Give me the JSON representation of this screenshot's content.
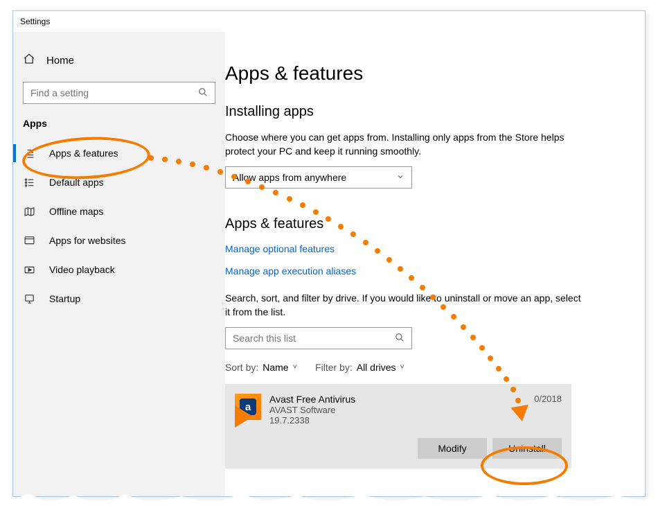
{
  "window_title": "Settings",
  "sidebar": {
    "home_label": "Home",
    "search_placeholder": "Find a setting",
    "section_label": "Apps",
    "items": [
      {
        "label": "Apps & features",
        "active": true
      },
      {
        "label": "Default apps"
      },
      {
        "label": "Offline maps"
      },
      {
        "label": "Apps for websites"
      },
      {
        "label": "Video playback"
      },
      {
        "label": "Startup"
      }
    ]
  },
  "content": {
    "page_title": "Apps & features",
    "section_install_title": "Installing apps",
    "install_desc": "Choose where you can get apps from. Installing only apps from the Store helps protect your PC and keep it running smoothly.",
    "install_option": "Allow apps from anywhere",
    "subsection_title": "Apps & features",
    "link_optional": "Manage optional features",
    "link_aliases": "Manage app execution aliases",
    "filter_desc": "Search, sort, and filter by drive. If you would like to uninstall or move an app, select it from the list.",
    "filter_search_placeholder": "Search this list",
    "sort_label": "Sort by:",
    "sort_value": "Name",
    "filter_label": "Filter by:",
    "filter_value": "All drives",
    "app": {
      "name": "Avast Free Antivirus",
      "vendor": "AVAST Software",
      "version": "19.7.2338",
      "date": "0/2018",
      "modify_btn": "Modify",
      "uninstall_btn": "Uninstall"
    }
  },
  "annotation": {
    "accent": "#f57c00"
  }
}
